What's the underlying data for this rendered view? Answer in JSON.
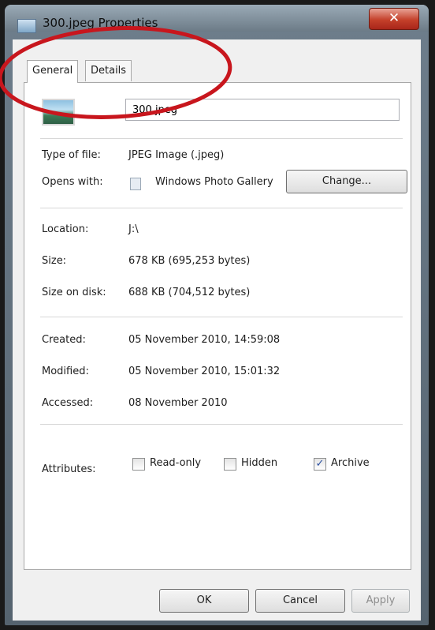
{
  "window": {
    "title": "300.jpeg Properties",
    "close_symbol": "✕"
  },
  "tabs": [
    {
      "label": "General",
      "active": true
    },
    {
      "label": "Details",
      "active": false
    }
  ],
  "file": {
    "icon": "image-file-icon",
    "name": "300.jpeg"
  },
  "info": {
    "type_label": "Type of file:",
    "type_value": "JPEG Image (.jpeg)",
    "opens_label": "Opens with:",
    "opens_value": "Windows Photo Gallery",
    "change_button": "Change...",
    "location_label": "Location:",
    "location_value": "J:\\",
    "size_label": "Size:",
    "size_value": "678 KB (695,253 bytes)",
    "disk_label": "Size on disk:",
    "disk_value": "688 KB (704,512 bytes)",
    "created_label": "Created:",
    "created_value": "05 November 2010, 14:59:08",
    "modified_label": "Modified:",
    "modified_value": "05 November 2010, 15:01:32",
    "accessed_label": "Accessed:",
    "accessed_value": "08 November 2010"
  },
  "attributes": {
    "label": "Attributes:",
    "readonly_label": "Read-only",
    "readonly_checked": false,
    "hidden_label": "Hidden",
    "hidden_checked": false,
    "archive_label": "Archive",
    "archive_checked": true
  },
  "buttons": {
    "ok": "OK",
    "cancel": "Cancel",
    "apply": "Apply"
  },
  "colors": {
    "annotation": "#c8161d",
    "close_button": "#c4402a"
  }
}
